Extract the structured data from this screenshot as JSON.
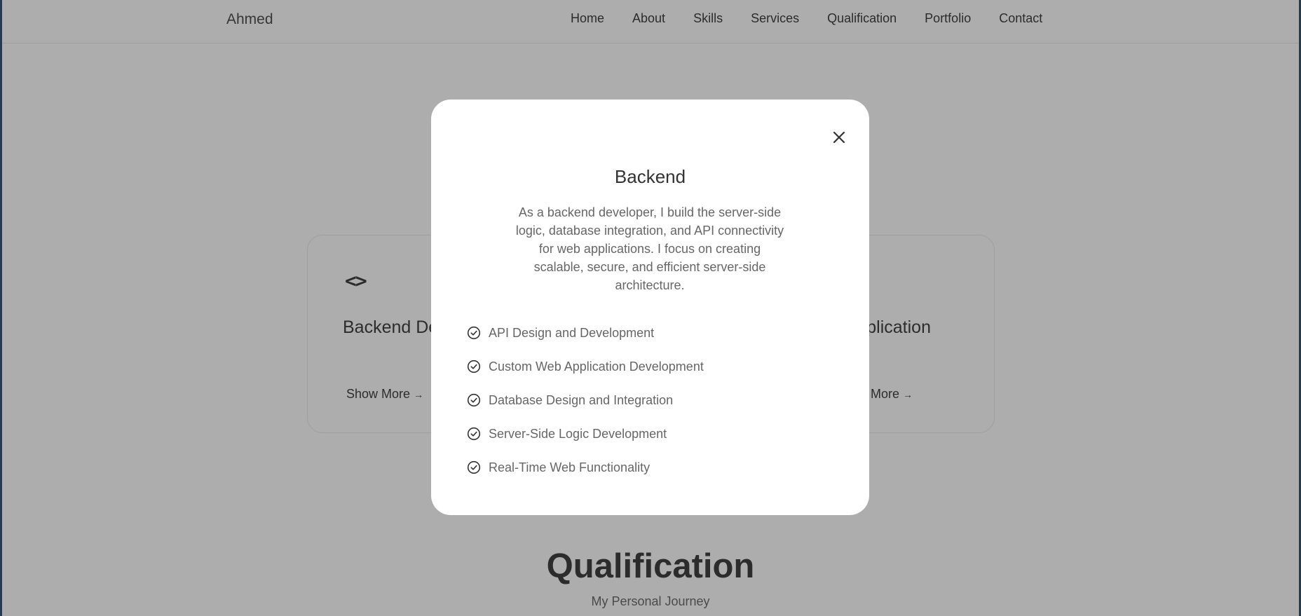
{
  "header": {
    "logo": "Ahmed",
    "nav": [
      "Home",
      "About",
      "Skills",
      "Services",
      "Qualification",
      "Portfolio",
      "Contact"
    ]
  },
  "cards": {
    "left": {
      "icon": "code-icon",
      "title": "Backend Developer",
      "more": "Show More"
    },
    "right": {
      "title": "Desktop Application",
      "more": "Show More"
    }
  },
  "qualification": {
    "title": "Qualification",
    "subtitle": "My Personal Journey"
  },
  "modal": {
    "title": "Backend",
    "description": "As a backend developer, I build the server-side logic, database integration, and API connectivity for web applications. I focus on creating scalable, secure, and efficient server-side architecture.",
    "features": [
      "API Design and Development",
      "Custom Web Application Development",
      "Database Design and Integration",
      "Server-Side Logic Development",
      "Real-Time Web Functionality"
    ]
  }
}
